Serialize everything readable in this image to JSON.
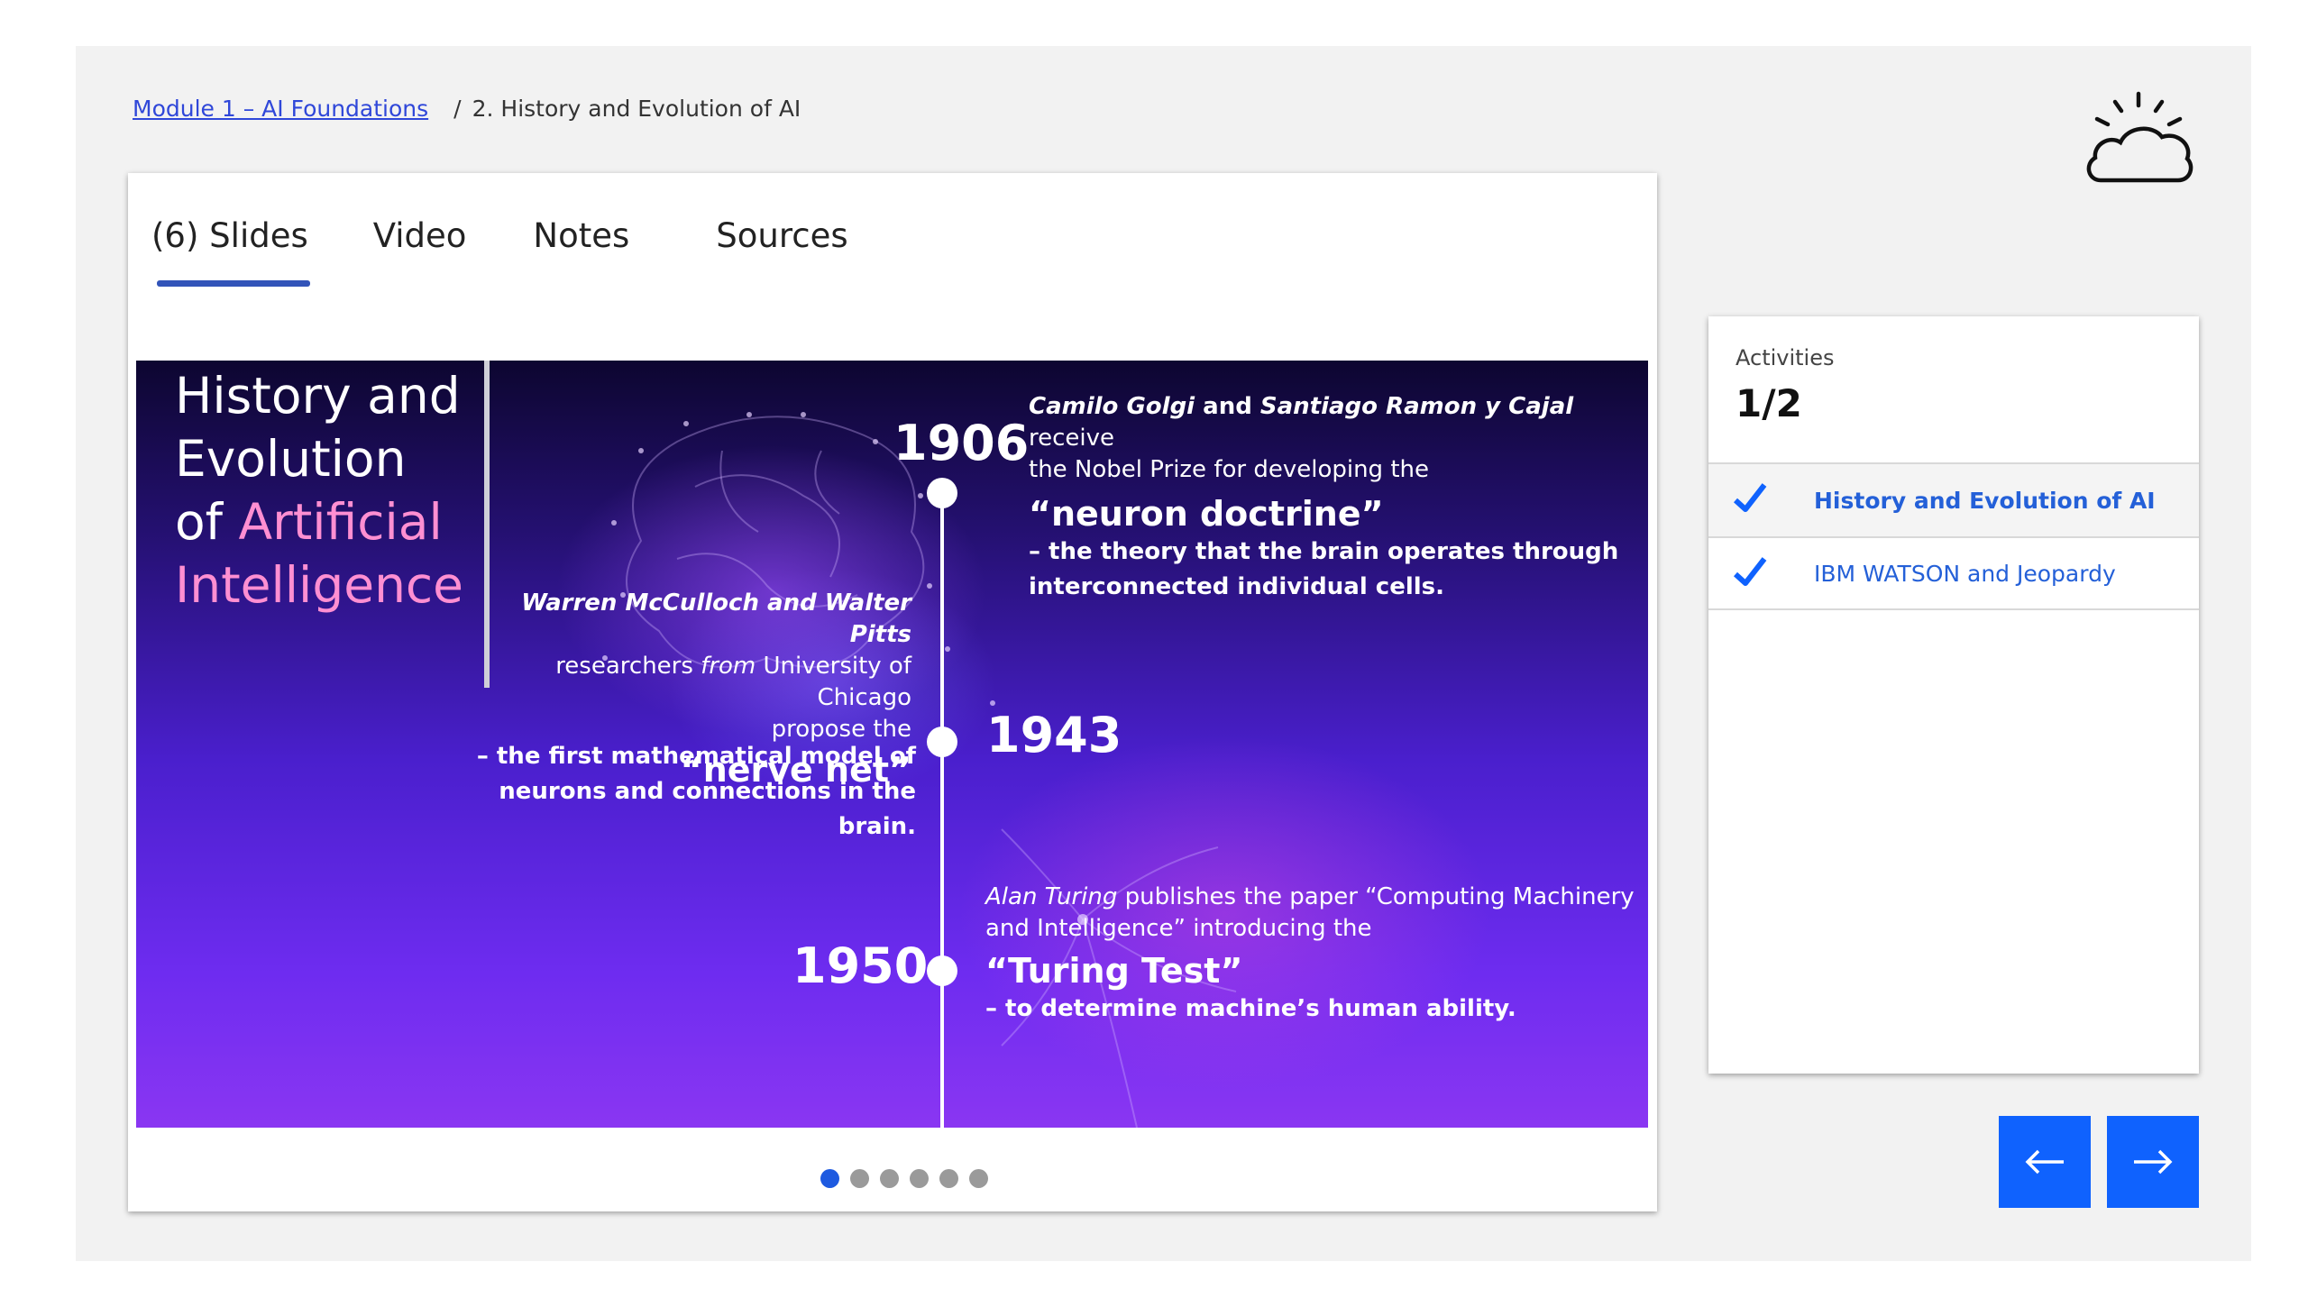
{
  "breadcrumb": {
    "module_link": "Module 1 – AI Foundations",
    "separator": "/",
    "current": "2. History and Evolution of AI"
  },
  "tabs": [
    "(6) Slides",
    "Video",
    "Notes",
    "Sources"
  ],
  "active_tab": 0,
  "slide": {
    "title_line1": "History and",
    "title_line2": "Evolution",
    "title_line3_prefix": "of ",
    "title_line3_highlight": "Artificial",
    "title_line4": "Intelligence",
    "events": {
      "e1906": {
        "year": "1906",
        "name1": "Camilo Golgi",
        "and": " and ",
        "name2": "Santiago Ramon y Cajal",
        "receive": " receive",
        "line2": "the Nobel Prize for developing the",
        "headline": "“neuron doctrine”",
        "desc1": "– the theory that the brain operates through",
        "desc2": "interconnected individual cells."
      },
      "e1943": {
        "year": "1943",
        "names": "Warren McCulloch and Walter Pitts",
        "line2_a": "researchers ",
        "line2_from": "from",
        "line2_b": " University of Chicago",
        "line3": "propose the",
        "headline": "“nerve net”",
        "desc1": "– the first mathematical model of",
        "desc2": "neurons and connections in the",
        "desc3": "brain."
      },
      "e1950": {
        "year": "1950",
        "name": "Alan Turing",
        "line1_rest": " publishes the paper “Computing Machinery",
        "line2": "and Intelligence” introducing the",
        "headline": "“Turing Test”",
        "desc1": "– to determine machine’s human ability."
      }
    }
  },
  "pagination": {
    "total": 6,
    "current": 1
  },
  "activities": {
    "label": "Activities",
    "count": "1/2",
    "items": [
      {
        "label": "History and Evolution of AI",
        "completed": true,
        "current": true
      },
      {
        "label": "IBM WATSON and Jeopardy",
        "completed": true,
        "current": false
      }
    ]
  },
  "nav": {
    "prev_icon": "arrow-left-icon",
    "next_icon": "arrow-right-icon"
  },
  "colors": {
    "accent": "#0f62fe",
    "tab_underline": "#3254b9",
    "link": "#2460d8",
    "highlight_pink": "#ff8fd2"
  },
  "logo_icon": "sun-cloud-icon"
}
